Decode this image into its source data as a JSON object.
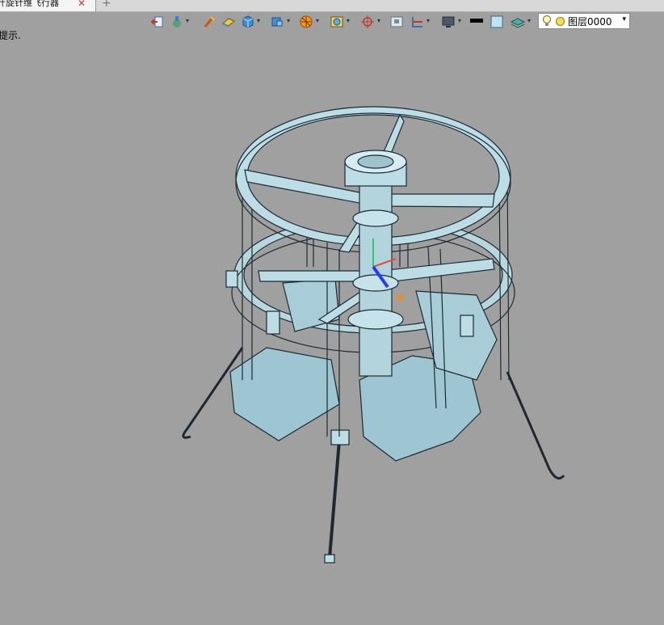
{
  "tab": {
    "title": "叶旋针维飞行器",
    "close_glyph": "✕",
    "add_glyph": "+"
  },
  "hint": "提示.",
  "toolbar": {
    "icons": [
      "exit-icon",
      "paint-icon",
      "brush-icon",
      "eraser-icon",
      "cube-icon",
      "view-cube-icon",
      "render-icon",
      "display-mode-icon",
      "coordinate-icon",
      "frame-icon",
      "section-icon",
      "screen-icon",
      "line-color-icon",
      "fill-color-icon",
      "layer-stack-icon"
    ],
    "line_color": "#000000",
    "fill_color": "#bfe4f0"
  },
  "layer": {
    "name": "图层0000",
    "color": "#f4e050"
  },
  "colors": {
    "viewport_bg": "#a0a0a0",
    "model_fill": "#bcdde6",
    "model_edge": "#1c2a30"
  }
}
